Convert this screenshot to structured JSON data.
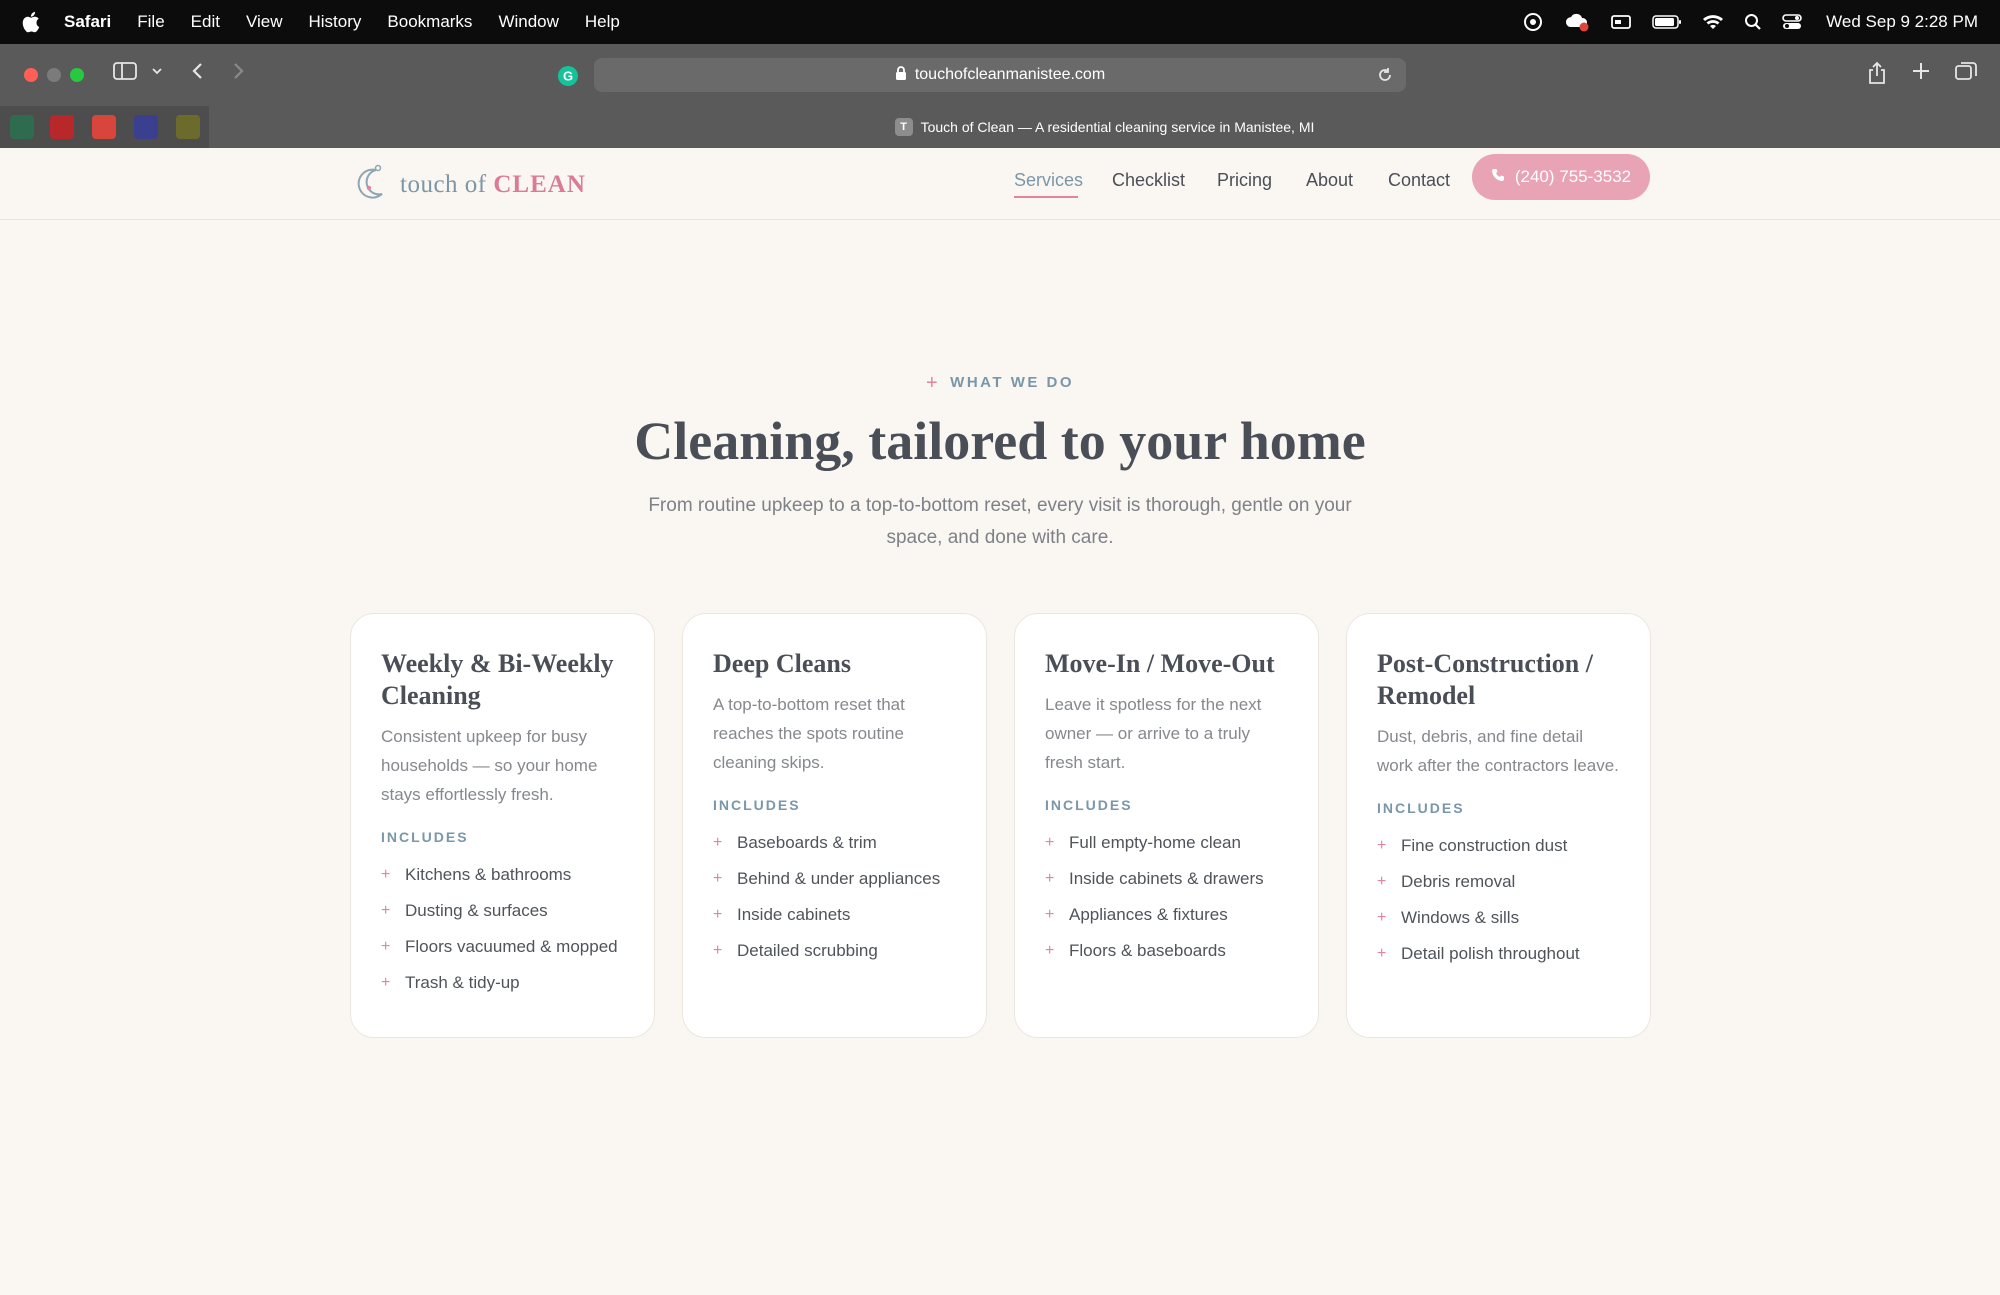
{
  "menubar": {
    "app_name": "Safari",
    "items": [
      "File",
      "Edit",
      "View",
      "History",
      "Bookmarks",
      "Window",
      "Help"
    ],
    "clock": "Wed Sep 9  2:28 PM"
  },
  "browser": {
    "url": "touchofcleanmanistee.com",
    "tab_title": "Touch of Clean — A residential cleaning service in Manistee, MI",
    "tab_favicon_letter": "T"
  },
  "site": {
    "logo_prefix": "touch of",
    "logo_brand": "CLEAN",
    "nav": [
      "Services",
      "Checklist",
      "Pricing",
      "About",
      "Contact"
    ],
    "active_nav": "Services",
    "phone": "(240) 755-3532"
  },
  "hero": {
    "eyebrow_mark": "+",
    "eyebrow": "WHAT WE DO",
    "title": "Cleaning, tailored to your home",
    "lead": "From routine upkeep to a top-to-bottom reset, every visit is thorough, gentle on your space, and done with care."
  },
  "cards": [
    {
      "title": "Weekly & Bi-Weekly Cleaning",
      "description": "Consistent upkeep for busy households — so your home stays effortlessly fresh.",
      "includes_label": "INCLUDES",
      "items": [
        "Kitchens & bathrooms",
        "Dusting & surfaces",
        "Floors vacuumed & mopped",
        "Trash & tidy-up"
      ]
    },
    {
      "title": "Deep Cleans",
      "description": "A top-to-bottom reset that reaches the spots routine cleaning skips.",
      "includes_label": "INCLUDES",
      "items": [
        "Baseboards & trim",
        "Behind & under appliances",
        "Inside cabinets",
        "Detailed scrubbing"
      ]
    },
    {
      "title": "Move-In / Move-Out",
      "description": "Leave it spotless for the next owner — or arrive to a truly fresh start.",
      "includes_label": "INCLUDES",
      "items": [
        "Full empty-home clean",
        "Inside cabinets & drawers",
        "Appliances & fixtures",
        "Floors & baseboards"
      ]
    },
    {
      "title": "Post-Construction / Remodel",
      "description": "Dust, debris, and fine detail work after the contractors leave.",
      "includes_label": "INCLUDES",
      "items": [
        "Fine construction dust",
        "Debris removal",
        "Windows & sills",
        "Detail polish throughout"
      ]
    }
  ],
  "colors": {
    "accent_pink": "#e2849d",
    "accent_blue": "#7a97aa",
    "page_background": "#faf7f2"
  }
}
